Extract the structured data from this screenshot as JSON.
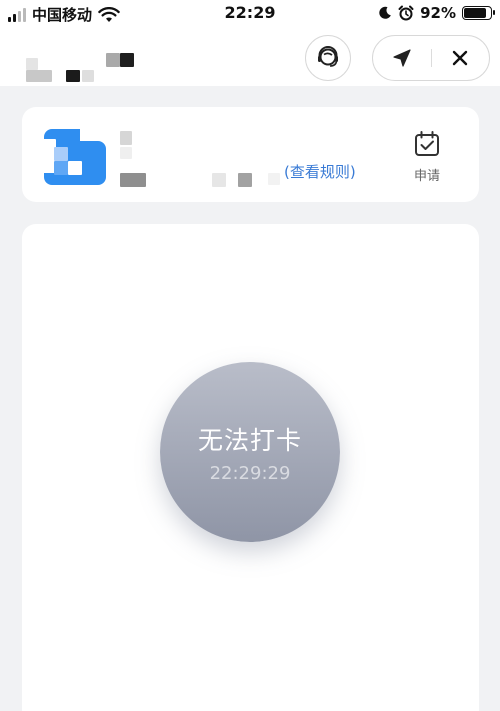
{
  "status_bar": {
    "carrier": "中国移动",
    "time": "22:29",
    "battery_percent_label": "92%",
    "battery_level": 0.92,
    "icons": [
      "signal-icon",
      "wifi-icon",
      "moon-icon",
      "alarm-icon",
      "battery-icon"
    ]
  },
  "nav": {
    "icons": [
      "customer-service-icon",
      "location-arrow-icon",
      "close-icon"
    ]
  },
  "info_card": {
    "rules_link": "(查看规则)",
    "apply_label": "申请",
    "apply_icon": "calendar-check-icon"
  },
  "punch": {
    "label": "无法打卡",
    "time": "22:29:29"
  },
  "colors": {
    "accent_blue": "#3a7bd5",
    "punch_gradient_top": "#b9bdc9",
    "punch_gradient_bottom": "#8f95a6",
    "page_background": "#f1f2f4"
  }
}
